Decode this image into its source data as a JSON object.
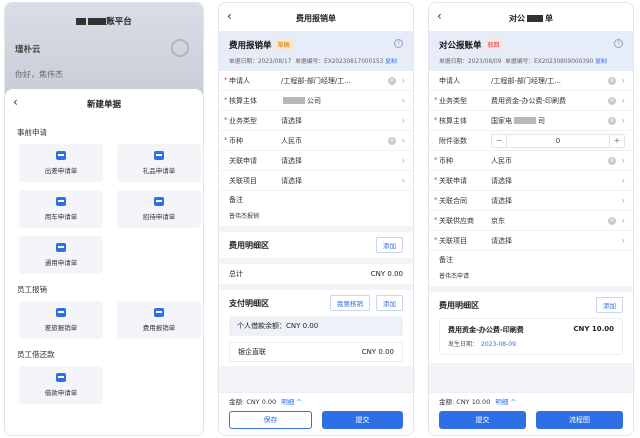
{
  "panel1": {
    "app_title_visible": "账平台",
    "org": "瑾朴云",
    "greeting": "你好，",
    "greeting_name": "焦伟杰",
    "sheet_title": "新建单据",
    "back": "‹",
    "sections": [
      {
        "title": "事前申请",
        "items": [
          "出差申请单",
          "礼品申请单",
          "用车申请单",
          "招待申请单",
          "通用申请单"
        ]
      },
      {
        "title": "员工报销",
        "items": [
          "差旅报销单",
          "费用报销单"
        ]
      },
      {
        "title": "员工借还款",
        "items": [
          "借款申请单"
        ]
      }
    ]
  },
  "panel2": {
    "nav_title": "费用报销单",
    "form_title": "费用报销单",
    "status": "草稿",
    "date_label": "单据日期：2023/08/17",
    "no_label": "单据编号：EX20230817000153",
    "copy": "复制",
    "fields": [
      {
        "label": "申请人",
        "value": "/工程部-部门经理/工...",
        "required": true,
        "clear": true
      },
      {
        "label": "核算主体",
        "value": "",
        "value_tail": "公司",
        "required": true,
        "clear": false
      },
      {
        "label": "业务类型",
        "value": "请选择",
        "required": true,
        "clear": false
      },
      {
        "label": "币种",
        "value": "人民币",
        "required": true,
        "clear": true
      },
      {
        "label": "关联申请",
        "value": "请选择",
        "required": false,
        "clear": false
      },
      {
        "label": "关联项目",
        "value": "请选择",
        "required": false,
        "clear": false
      }
    ],
    "remark_label": "备注",
    "remark_value": "普伟杰报销",
    "detail_title": "费用明细区",
    "add": "添加",
    "total_label": "总计",
    "total_value": "CNY 0.00",
    "pay_title": "支付明细区",
    "verify_btn": "我要核销",
    "add2": "添加",
    "debt_text": "个人借款余额：CNY 0.00",
    "bank_label": "银企直联",
    "bank_value": "CNY 0.00",
    "amount_label": "金额:",
    "amount_value": "CNY 0.00",
    "detail_link": "明细 ^",
    "save": "保存",
    "submit": "提交"
  },
  "panel3": {
    "nav_title_a": "对公",
    "nav_title_b": "单",
    "form_title": "对公报账单",
    "status": "驳回",
    "date_label": "单据日期：2023/08/09",
    "no_label": "单据编号：EX20230809000390",
    "copy": "复制",
    "fields": [
      {
        "label": "申请人",
        "value": "/工程部-部门经理/工...",
        "required": false,
        "clear": true
      },
      {
        "label": "业务类型",
        "value": "费用资金-办公费-印刷费",
        "required": true,
        "clear": true
      },
      {
        "label": "核算主体",
        "value": "国家电",
        "value_tail": "司",
        "required": true,
        "clear": true
      }
    ],
    "attach_label": "附件张数",
    "attach_value": "0",
    "fields2": [
      {
        "label": "币种",
        "value": "人民币",
        "required": true,
        "clear": true
      },
      {
        "label": "关联申请",
        "value": "请选择",
        "required": true,
        "clear": false
      },
      {
        "label": "关联合同",
        "value": "请选择",
        "required": true,
        "clear": false
      },
      {
        "label": "关联供应商",
        "value": "京东",
        "required": true,
        "clear": true
      },
      {
        "label": "关联项目",
        "value": "请选择",
        "required": true,
        "clear": false
      }
    ],
    "remark_label": "备注",
    "remark_value": "普伟杰申请",
    "detail_title": "费用明细区",
    "add": "添加",
    "item_name": "费用资金-办公费-印刷费",
    "item_amount": "CNY 10.00",
    "item_date_label": "发生日期：",
    "item_date": "2023-08-09",
    "amount_label": "金额:",
    "amount_value": "CNY 10.00",
    "detail_link": "明细 ^",
    "submit": "提交",
    "flow": "流程图"
  }
}
